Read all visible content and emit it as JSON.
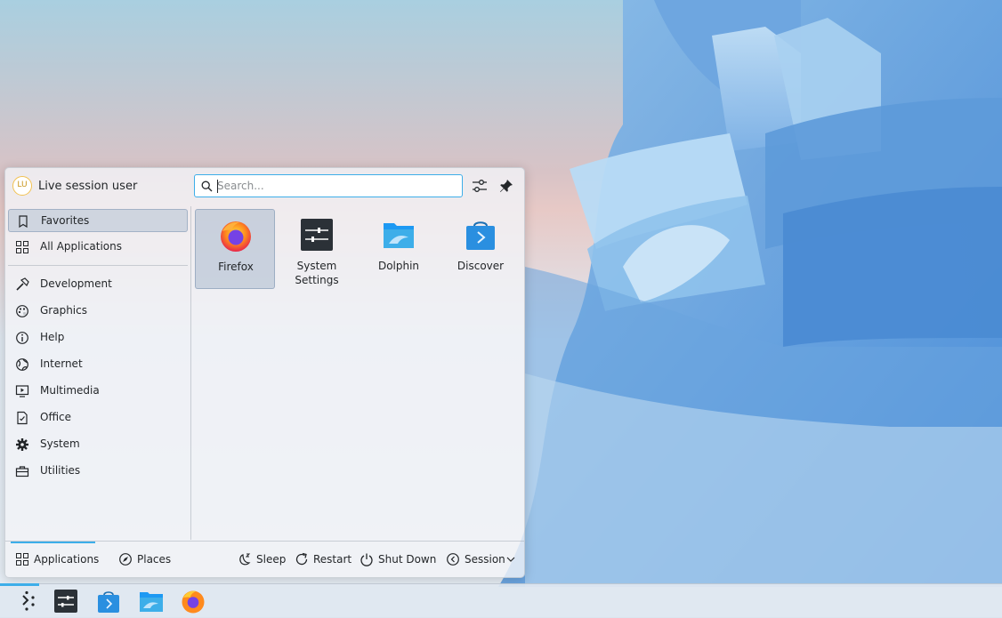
{
  "user": {
    "name": "Live session user",
    "initials": "LU"
  },
  "search": {
    "placeholder": "Search..."
  },
  "header_buttons": {
    "configure_icon": "sliders-icon",
    "pin_icon": "pin-icon"
  },
  "categories": [
    {
      "label": "Favorites",
      "icon": "bookmark-icon",
      "active": true
    },
    {
      "label": "All Applications",
      "icon": "grid-icon"
    },
    {
      "label": "Development",
      "icon": "hammer-icon"
    },
    {
      "label": "Graphics",
      "icon": "palette-icon"
    },
    {
      "label": "Help",
      "icon": "info-icon"
    },
    {
      "label": "Internet",
      "icon": "globe-icon"
    },
    {
      "label": "Multimedia",
      "icon": "monitor-play-icon"
    },
    {
      "label": "Office",
      "icon": "document-icon"
    },
    {
      "label": "System",
      "icon": "gear-icon"
    },
    {
      "label": "Utilities",
      "icon": "toolbox-icon"
    }
  ],
  "favorites": [
    {
      "label": "Firefox",
      "icon": "firefox-icon",
      "selected": true
    },
    {
      "label": "System Settings",
      "icon": "system-settings-icon"
    },
    {
      "label": "Dolphin",
      "icon": "folder-icon"
    },
    {
      "label": "Discover",
      "icon": "discover-bag-icon"
    }
  ],
  "footer": {
    "tabs": [
      {
        "label": "Applications",
        "icon": "grid-icon",
        "active": true
      },
      {
        "label": "Places",
        "icon": "compass-icon"
      }
    ],
    "actions": [
      {
        "label": "Sleep",
        "icon": "sleep-icon"
      },
      {
        "label": "Restart",
        "icon": "restart-icon"
      },
      {
        "label": "Shut Down",
        "icon": "power-icon"
      },
      {
        "label": "Session",
        "icon": "session-icon"
      }
    ]
  },
  "taskbar": {
    "items": [
      "launcher-icon",
      "system-settings-icon",
      "discover-bag-icon",
      "folder-icon",
      "firefox-icon"
    ]
  },
  "colors": {
    "accent": "#3daee9",
    "text": "#232629",
    "panel": "#f1f3f6"
  }
}
